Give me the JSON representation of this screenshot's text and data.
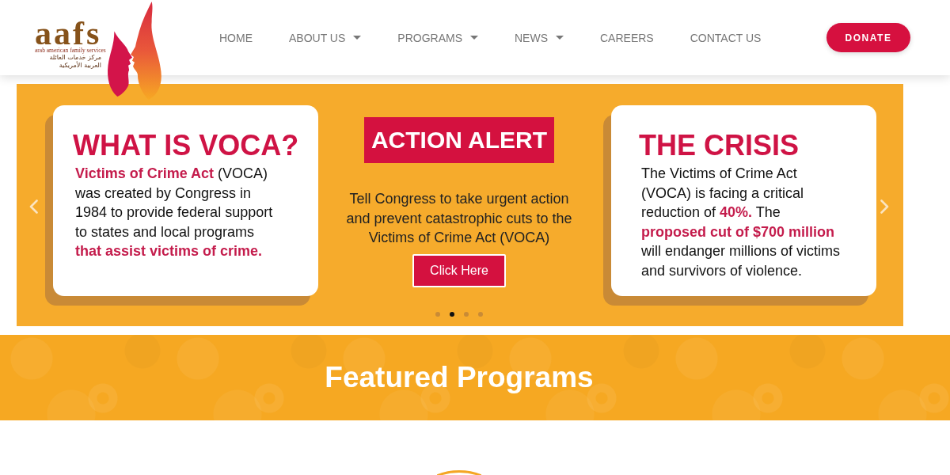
{
  "header": {
    "logo": {
      "wordmark": "aafs",
      "tagline": "arab american family services",
      "tagline_arabic": "مركز خدمات العائلة العربية الأمريكية"
    },
    "nav": [
      {
        "label": "HOME",
        "has_dropdown": false
      },
      {
        "label": "ABOUT US",
        "has_dropdown": true
      },
      {
        "label": "PROGRAMS",
        "has_dropdown": true
      },
      {
        "label": "NEWS",
        "has_dropdown": true
      },
      {
        "label": "CAREERS",
        "has_dropdown": false
      },
      {
        "label": "CONTACT US",
        "has_dropdown": false
      }
    ],
    "donate_button": "DONATE"
  },
  "slider": {
    "panels": [
      {
        "kind": "card",
        "title": "WHAT IS VOCA?",
        "text": "**Victims of Crime Act** (VOCA)\nwas created by Congress in\n1984 to provide federal support\nto states and local programs\n**that assist victims of crime.**"
      },
      {
        "kind": "alert",
        "title": "ACTION ALERT",
        "text": "Tell Congress to take urgent action\nand prevent catastrophic cuts to the\nVictims of Crime Act (VOCA)",
        "button": "Click Here"
      },
      {
        "kind": "card",
        "title": "THE CRISIS",
        "text": "The Victims of Crime Act\n(VOCA) is facing a critical\nreduction of **40%.** The\n**proposed cut of $700 million**\nwill endanger millions of victims\nand survivors of violence."
      }
    ],
    "dots": [
      {
        "selected": false
      },
      {
        "selected": true
      },
      {
        "selected": false
      },
      {
        "selected": false
      }
    ]
  },
  "featured": {
    "title": "Featured Programs"
  }
}
